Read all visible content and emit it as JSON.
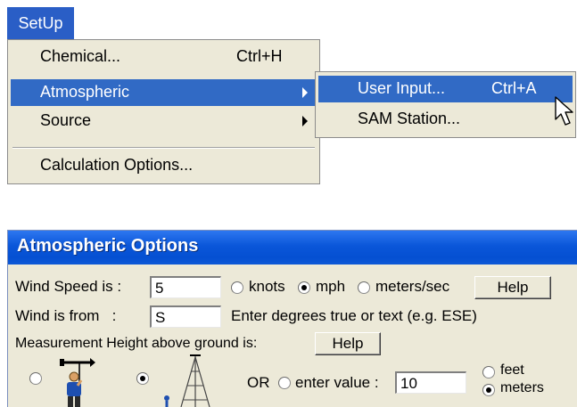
{
  "menubar": {
    "setup_label": "SetUp"
  },
  "setup_menu": {
    "items": [
      {
        "label": "Chemical...",
        "shortcut": "Ctrl+H"
      },
      {
        "label": "Atmospheric",
        "shortcut": ""
      },
      {
        "label": "Source",
        "shortcut": ""
      },
      {
        "label": "Calculation Options...",
        "shortcut": ""
      }
    ]
  },
  "atmospheric_submenu": {
    "items": [
      {
        "label": "User Input...",
        "shortcut": "Ctrl+A"
      },
      {
        "label": "SAM Station...",
        "shortcut": ""
      }
    ]
  },
  "dialog": {
    "title": "Atmospheric Options",
    "wind_speed": {
      "label": "Wind Speed is :",
      "value": "5",
      "units": [
        {
          "label": "knots",
          "selected": false
        },
        {
          "label": "mph",
          "selected": true
        },
        {
          "label": "meters/sec",
          "selected": false
        }
      ],
      "help_label": "Help"
    },
    "wind_from": {
      "label": "Wind is from   :",
      "value": "S",
      "hint": "Enter degrees true or text (e.g. ESE)"
    },
    "measurement": {
      "label": "Measurement Height above ground is:",
      "help_label": "Help",
      "or_label": "OR",
      "enter_value_label": "enter value :",
      "value": "10",
      "units": [
        {
          "label": "feet",
          "selected": false
        },
        {
          "label": "meters",
          "selected": true
        }
      ]
    }
  },
  "colors": {
    "menu_highlight": "#316ac5",
    "titlebar": "#0550d2",
    "window_bg": "#ece9d8"
  }
}
